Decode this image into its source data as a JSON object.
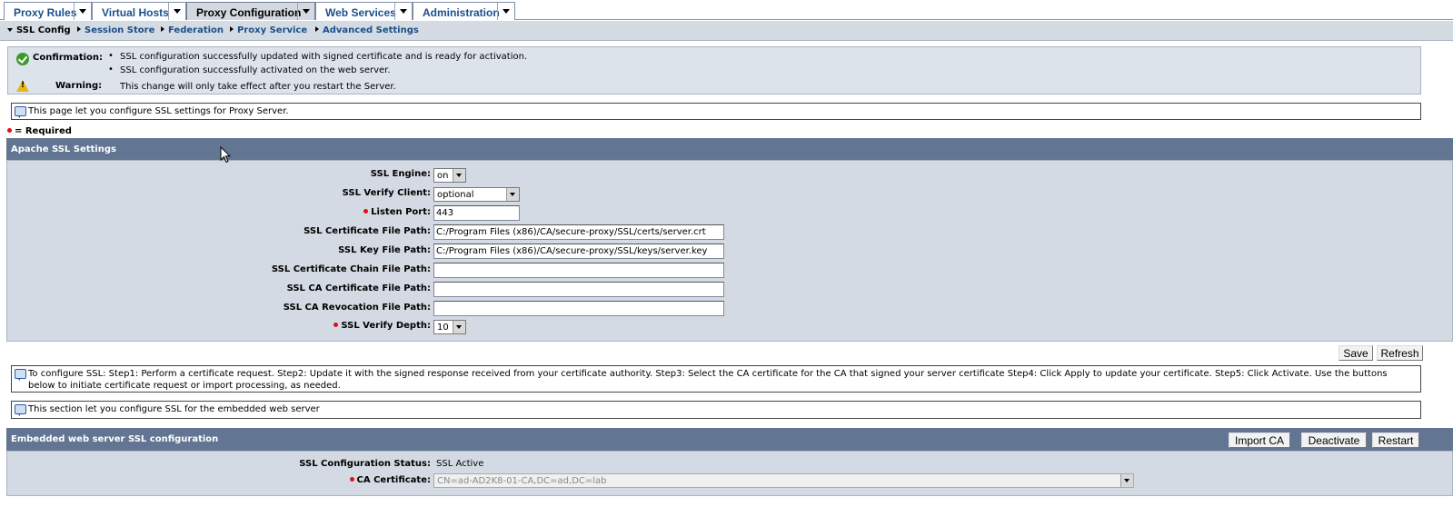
{
  "tabs": [
    {
      "label": "Proxy Rules",
      "active": false
    },
    {
      "label": "Virtual Hosts",
      "active": false
    },
    {
      "label": "Proxy Configuration",
      "active": true
    },
    {
      "label": "Web Services",
      "active": false
    },
    {
      "label": "Administration",
      "active": false
    }
  ],
  "subnav": [
    {
      "label": "SSL Config",
      "current": true
    },
    {
      "label": "Session Store",
      "current": false
    },
    {
      "label": "Federation",
      "current": false
    },
    {
      "label": "Proxy Service",
      "current": false
    },
    {
      "label": "Advanced Settings",
      "current": false
    }
  ],
  "messages": {
    "confirmation_label": "Confirmation:",
    "confirmation_items": [
      "SSL configuration successfully updated with signed certificate and is ready for activation.",
      "SSL configuration successfully activated on the web server."
    ],
    "warning_label": "Warning:",
    "warning_text": "This change will only take effect after you restart the Server."
  },
  "page_info": "This page let you configure SSL settings for Proxy Server.",
  "required_legend": "= Required",
  "apache_section": {
    "title": "Apache SSL Settings",
    "fields": {
      "ssl_engine": {
        "label": "SSL Engine:",
        "value": "on"
      },
      "ssl_verify_client": {
        "label": "SSL Verify Client:",
        "value": "optional"
      },
      "listen_port": {
        "label": "Listen Port:",
        "value": "443"
      },
      "cert_file_path": {
        "label": "SSL Certificate File Path:",
        "value": "C:/Program Files (x86)/CA/secure-proxy/SSL/certs/server.crt"
      },
      "key_file_path": {
        "label": "SSL Key File Path:",
        "value": "C:/Program Files (x86)/CA/secure-proxy/SSL/keys/server.key"
      },
      "chain_file_path": {
        "label": "SSL Certificate Chain File Path:",
        "value": ""
      },
      "ca_cert_file_path": {
        "label": "SSL CA Certificate File Path:",
        "value": ""
      },
      "ca_revocation_file_path": {
        "label": "SSL CA Revocation File Path:",
        "value": ""
      },
      "verify_depth": {
        "label": "SSL Verify Depth:",
        "value": "10"
      }
    },
    "save_label": "Save",
    "refresh_label": "Refresh"
  },
  "steps_info": "To configure SSL: Step1: Perform a certificate request. Step2: Update it with the signed response received from your certificate authority. Step3: Select the CA certificate for the CA that signed your server certificate Step4: Click Apply to update your certificate. Step5: Click Activate. Use the buttons below to initiate certificate request or import processing, as needed.",
  "embedded_info": "This section let you configure SSL for the embedded web server",
  "embedded_section": {
    "title": "Embedded web server SSL configuration",
    "import_ca_label": "Import CA",
    "deactivate_label": "Deactivate",
    "restart_label": "Restart",
    "status_label": "SSL Configuration Status:",
    "status_value": "SSL Active",
    "ca_cert_label": "CA Certificate:",
    "ca_cert_value": "CN=ad-AD2K8-01-CA,DC=ad,DC=lab"
  },
  "colors": {
    "section_header": "#627592",
    "panel_bg": "#d4dae3",
    "link": "#1a4f8c",
    "required_dot": "#e01010"
  }
}
